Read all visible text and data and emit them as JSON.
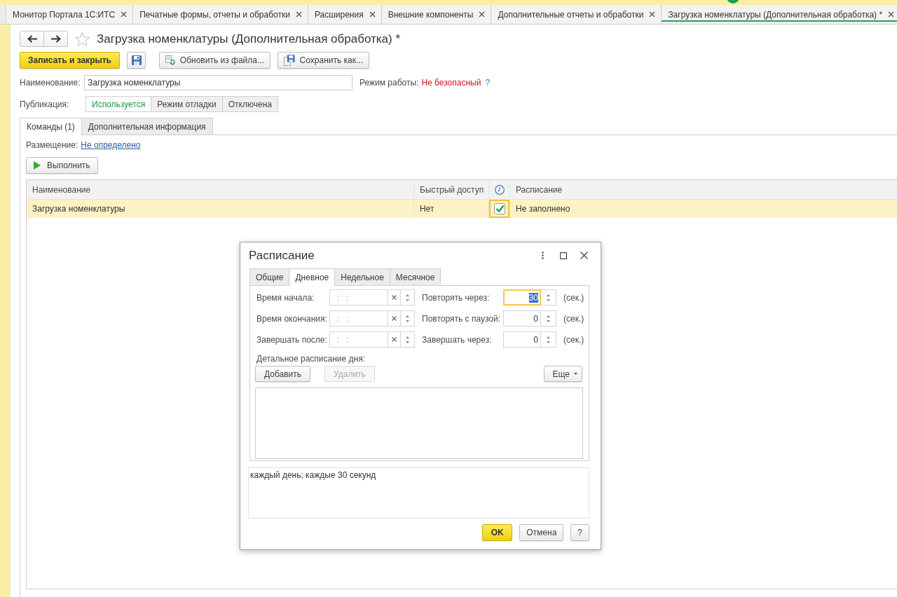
{
  "window_tabs": [
    {
      "label": "Монитор Портала 1С:ИТС",
      "selected": false
    },
    {
      "label": "Печатные формы, отчеты и обработки",
      "selected": false
    },
    {
      "label": "Расширения",
      "selected": false
    },
    {
      "label": "Внешние компоненты",
      "selected": false
    },
    {
      "label": "Дополнительные отчеты и обработки",
      "selected": false
    },
    {
      "label": "Загрузка номенклатуры (Дополнительная обработка) *",
      "selected": true
    }
  ],
  "form": {
    "title": "Загрузка номенклатуры (Дополнительная обработка) *",
    "favorite": false
  },
  "toolbar": [
    {
      "kind": "primary",
      "label": "Записать и закрыть"
    },
    {
      "kind": "save"
    },
    {
      "kind": "reload",
      "label": "Обновить из файла..."
    },
    {
      "kind": "saveas",
      "label": "Сохранить как..."
    }
  ],
  "name_field": {
    "label": "Наименование:",
    "value": "Загрузка номенклатуры"
  },
  "mode": {
    "label": "Режим работы:",
    "value": "Не безопасный",
    "help": "?"
  },
  "publication": {
    "label": "Публикация:",
    "options": [
      {
        "label": "Используется",
        "selected": true
      },
      {
        "label": "Режим отладки",
        "selected": false
      },
      {
        "label": "Отключена",
        "selected": false
      }
    ]
  },
  "tabs": [
    {
      "label": "Команды (1)",
      "selected": true
    },
    {
      "label": "Дополнительная информация",
      "selected": false
    }
  ],
  "placement": {
    "label": "Размещение:",
    "link": "Не определено"
  },
  "run_button": {
    "label": "Выполнить"
  },
  "table": {
    "columns": [
      {
        "kind": "text",
        "label": "Наименование"
      },
      {
        "kind": "text",
        "label": "Быстрый доступ"
      },
      {
        "kind": "icon"
      },
      {
        "kind": "text",
        "label": "Расписание"
      }
    ],
    "rows": [
      {
        "selected": true,
        "name": "Загрузка номенклатуры",
        "quick_access": "Нет",
        "scheduled": true,
        "scheduled_focused": true,
        "schedule": "Не заполнено"
      }
    ]
  },
  "dialog": {
    "title": "Расписание",
    "tabs": [
      {
        "label": "Общие",
        "selected": false
      },
      {
        "label": "Дневное",
        "selected": true
      },
      {
        "label": "Недельное",
        "selected": false
      },
      {
        "label": "Месячное",
        "selected": false
      }
    ],
    "time_fields": [
      {
        "label": "Время начала:",
        "placeholder": ": :"
      },
      {
        "label": "Время окончания:",
        "placeholder": ": :"
      },
      {
        "label": "Завершать после:",
        "placeholder": ": :"
      }
    ],
    "repeat_fields": [
      {
        "label": "Повторять через:",
        "value": "30",
        "unit": "(сек.)",
        "focused": true
      },
      {
        "label": "Повторять с паузой:",
        "value": "0",
        "unit": "(сек.)",
        "focused": false
      },
      {
        "label": "Завершать через:",
        "value": "0",
        "unit": "(сек.)",
        "focused": false
      }
    ],
    "detail": {
      "label": "Детальное расписание дня:",
      "buttons": [
        {
          "label": "Добавить",
          "disabled": false
        },
        {
          "label": "Удалить",
          "disabled": true
        }
      ],
      "more_button": "Еще"
    },
    "summary": "каждый день; каждые 30 секунд",
    "buttons": [
      {
        "kind": "primary",
        "label": "OK"
      },
      {
        "kind": "normal",
        "label": "Отмена"
      },
      {
        "kind": "normal",
        "label": "?"
      }
    ]
  }
}
